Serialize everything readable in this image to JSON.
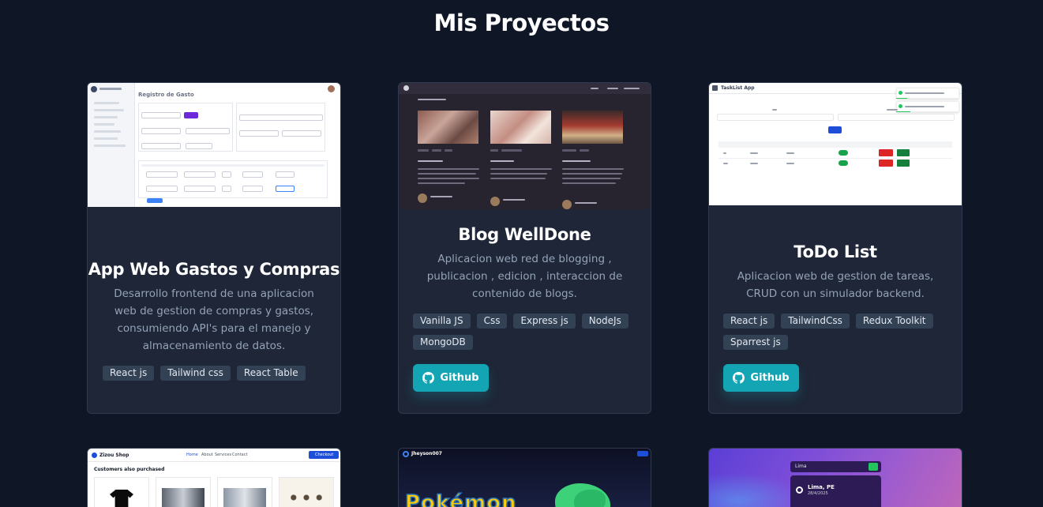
{
  "page": {
    "title": "Mis Proyectos"
  },
  "projects": [
    {
      "title": "App Web Gastos y Compras",
      "description": "Desarrollo frontend de una aplicacion web de gestion de compras y gastos, consumiendo API's para el manejo y almacenamiento de datos.",
      "tags": [
        "React js",
        "Tailwind css",
        "React Table"
      ],
      "thumb_heading": "Registro de Gasto"
    },
    {
      "title": "Blog WellDone",
      "description": "Aplicacion web red de blogging , publicacion , edicion , interaccion de contenido de blogs.",
      "tags": [
        "Vanilla JS",
        "Css",
        "Express js",
        "NodeJs",
        "MongoDB"
      ],
      "button": "Github"
    },
    {
      "title": "ToDo List",
      "description": "Aplicacion web de gestion de tareas, CRUD con un simulador backend.",
      "tags": [
        "React js",
        "TailwindCss",
        "Redux Toolkit",
        "Sparrest js"
      ],
      "button": "Github",
      "thumb_heading": "TaskList App"
    }
  ],
  "thumbs": {
    "shop_brand": "Zizou Shop",
    "shop_nav": [
      "Home",
      "About",
      "Services",
      "Contact"
    ],
    "shop_section": "Customers also purchased",
    "shop_checkout": "Checkout",
    "pokemon_user": "Jheyson007",
    "pokemon_logo": "Pokémon",
    "weather_search": "Lima",
    "weather_city": "Lima, PE",
    "weather_date": "28/4/2025"
  },
  "colors": {
    "background": "#0f1626",
    "card": "#1e2637",
    "tag": "#334155",
    "button": "#14a5b4"
  }
}
